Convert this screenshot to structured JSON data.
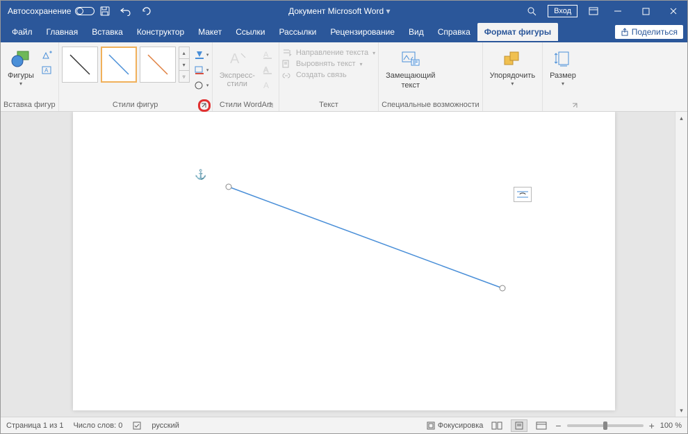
{
  "title": {
    "autosave": "Автосохранение",
    "doc": "Документ Microsoft Word",
    "login": "Вход"
  },
  "tabs": {
    "file": "Файл",
    "home": "Главная",
    "insert": "Вставка",
    "design": "Конструктор",
    "layout": "Макет",
    "refs": "Ссылки",
    "mail": "Рассылки",
    "review": "Рецензирование",
    "view": "Вид",
    "help": "Справка",
    "format": "Формат фигуры",
    "share": "Поделиться"
  },
  "ribbon": {
    "insert_shapes": {
      "label": "Вставка фигур",
      "shapes": "Фигуры"
    },
    "shape_styles": {
      "label": "Стили фигур"
    },
    "wordart": {
      "label": "Стили WordArt",
      "express": "Экспресс-\nстили"
    },
    "text": {
      "label": "Текст",
      "dir": "Направление текста",
      "align": "Выровнять текст",
      "link": "Создать связь"
    },
    "access": {
      "label": "Специальные возможности",
      "alt1": "Замещающий",
      "alt2": "текст"
    },
    "arrange": {
      "label": "Упорядочить"
    },
    "size": {
      "label": "Размер"
    }
  },
  "status": {
    "page": "Страница 1 из 1",
    "words": "Число слов: 0",
    "lang": "русский",
    "focus": "Фокусировка",
    "zoom": "100 %"
  }
}
